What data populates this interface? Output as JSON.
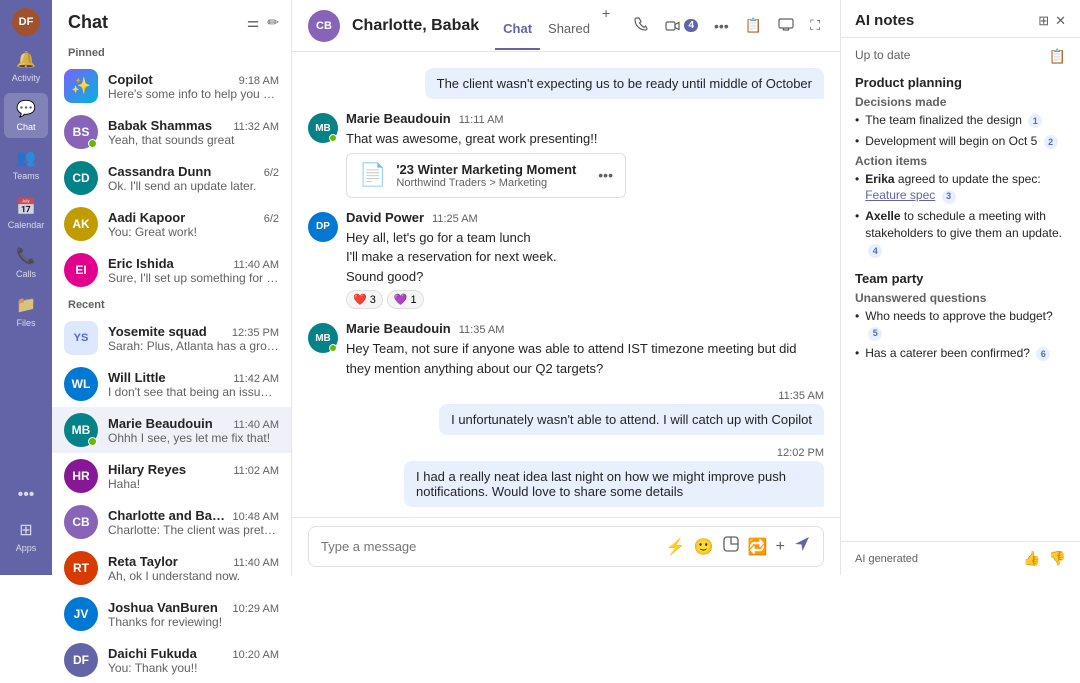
{
  "nav": {
    "items": [
      {
        "id": "activity",
        "label": "Activity",
        "icon": "🔔"
      },
      {
        "id": "chat",
        "label": "Chat",
        "icon": "💬",
        "active": true
      },
      {
        "id": "teams",
        "label": "Teams",
        "icon": "👥"
      },
      {
        "id": "calendar",
        "label": "Calendar",
        "icon": "📅"
      },
      {
        "id": "calls",
        "label": "Calls",
        "icon": "📞"
      },
      {
        "id": "files",
        "label": "Files",
        "icon": "📁"
      }
    ],
    "more_label": "•••",
    "apps_label": "Apps",
    "user_initials": "DF"
  },
  "chat_list": {
    "title": "Chat",
    "pinned_label": "Pinned",
    "recent_label": "Recent",
    "pinned": [
      {
        "id": "copilot",
        "name": "Copilot",
        "time": "9:18 AM",
        "preview": "Here's some info to help you prep for your...",
        "avatar_type": "copilot",
        "color": ""
      },
      {
        "id": "babak",
        "name": "Babak Shammas",
        "time": "11:32 AM",
        "preview": "Yeah, that sounds great",
        "avatar_type": "initial",
        "initials": "BS",
        "color": "#8764b8",
        "online": true
      },
      {
        "id": "cassandra",
        "name": "Cassandra Dunn",
        "time": "6/2",
        "preview": "Ok. I'll send an update later.",
        "avatar_type": "initial",
        "initials": "CD",
        "color": "#038387"
      },
      {
        "id": "aadi",
        "name": "Aadi Kapoor",
        "time": "6/2",
        "preview": "You: Great work!",
        "avatar_type": "initial",
        "initials": "AK",
        "color": "#c19c00"
      },
      {
        "id": "eric",
        "name": "Eric Ishida",
        "time": "11:40 AM",
        "preview": "Sure, I'll set up something for next week t...",
        "avatar_type": "initial",
        "initials": "EI",
        "color": "#e3008c"
      }
    ],
    "recent": [
      {
        "id": "yosemite",
        "name": "Yosemite squad",
        "time": "12:35 PM",
        "preview": "Sarah: Plus, Atlanta has a growing tech ...",
        "avatar_type": "group",
        "initials": "YS",
        "color": "#dde8ff"
      },
      {
        "id": "will",
        "name": "Will Little",
        "time": "11:42 AM",
        "preview": "I don't see that being an issue. Can you ta...",
        "avatar_type": "initial",
        "initials": "WL",
        "color": "#0078d4"
      },
      {
        "id": "marie",
        "name": "Marie Beaudouin",
        "time": "11:40 AM",
        "preview": "Ohhh I see, yes let me fix that!",
        "avatar_type": "initial",
        "initials": "MB",
        "color": "#038387",
        "online": true
      },
      {
        "id": "hilary",
        "name": "Hilary Reyes",
        "time": "11:02 AM",
        "preview": "Haha!",
        "avatar_type": "initial",
        "initials": "HR",
        "color": "#881798"
      },
      {
        "id": "charlotte_babak",
        "name": "Charlotte and Babak",
        "time": "10:48 AM",
        "preview": "Charlotte: The client was pretty happy with...",
        "avatar_type": "initial",
        "initials": "CB",
        "color": "#8764b8"
      },
      {
        "id": "reta",
        "name": "Reta Taylor",
        "time": "11:40 AM",
        "preview": "Ah, ok I understand now.",
        "avatar_type": "initial",
        "initials": "RT",
        "color": "#d83b01"
      },
      {
        "id": "joshua",
        "name": "Joshua VanBuren",
        "time": "10:29 AM",
        "preview": "Thanks for reviewing!",
        "avatar_type": "initial",
        "initials": "JV",
        "color": "#0078d4"
      },
      {
        "id": "daichi",
        "name": "Daichi Fukuda",
        "time": "10:20 AM",
        "preview": "You: Thank you!!",
        "avatar_type": "initial",
        "initials": "DF",
        "color": "#6264a7"
      }
    ]
  },
  "main_chat": {
    "contact_name": "Charlotte, Babak",
    "contact_initials": "CB",
    "contact_avatar_color": "#8764b8",
    "tabs": [
      {
        "id": "chat",
        "label": "Chat",
        "active": true
      },
      {
        "id": "shared",
        "label": "Shared",
        "active": false
      }
    ],
    "tab_add_icon": "+",
    "header_actions": {
      "call_icon": "📞",
      "video_count": "4",
      "more_icon": "•••",
      "notes_icon": "📝",
      "screen_icon": "🖥",
      "expand_icon": "⛶"
    },
    "messages": [
      {
        "id": "m1",
        "type": "bubble_right",
        "text": "The client wasn't expecting us to be ready until middle of October"
      },
      {
        "id": "m2",
        "type": "group",
        "sender": "Marie Beaudouin",
        "time": "11:11 AM",
        "avatar_initials": "MB",
        "avatar_color": "#038387",
        "online": true,
        "messages": [
          {
            "text": "That was awesome, great work presenting!!"
          },
          {
            "type": "attachment",
            "name": "'23 Winter Marketing Moment",
            "path": "Northwind Traders > Marketing",
            "icon": "📄"
          }
        ]
      },
      {
        "id": "m3",
        "type": "group",
        "sender": "David Power",
        "time": "11:25 AM",
        "avatar_initials": "DP",
        "avatar_color": "#0078d4",
        "messages": [
          {
            "text": "Hey all, let's go for a team lunch"
          },
          {
            "text": "I'll make a reservation for next week."
          },
          {
            "text": "Sound good?"
          }
        ],
        "reactions": [
          {
            "emoji": "❤️",
            "count": "3"
          },
          {
            "emoji": "💜",
            "count": "1"
          }
        ]
      },
      {
        "id": "m4",
        "type": "group",
        "sender": "Marie Beaudouin",
        "time": "11:35 AM",
        "avatar_initials": "MB",
        "avatar_color": "#038387",
        "online": true,
        "messages": [
          {
            "text": "Hey Team, not sure if anyone was able to attend IST timezone meeting but did they mention anything about our Q2 targets?"
          }
        ]
      },
      {
        "id": "m5",
        "type": "bubble_right",
        "time_label": "11:35 AM",
        "text": "I unfortunately wasn't able to attend. I will catch up with Copilot"
      },
      {
        "id": "m6",
        "type": "bubble_right",
        "time_label": "12:02 PM",
        "text": "I had a really neat idea last night on how we might improve push notifications. Would love to share some details"
      }
    ],
    "input_placeholder": "Type a message"
  },
  "ai_notes": {
    "title": "AI notes",
    "date_label": "Up to date",
    "sections": [
      {
        "title": "Product planning",
        "decisions_label": "Decisions made",
        "decisions": [
          {
            "text": "The team finalized the design",
            "num": "1"
          },
          {
            "text": "Development will begin on Oct 5",
            "num": "2"
          }
        ],
        "actions_label": "Action items",
        "actions": [
          {
            "bold": "Erika",
            "text": " agreed to update the spec:",
            "link": "Feature spec",
            "link_num": "3"
          },
          {
            "bold": "Axelle",
            "text": " to schedule a meeting with stakeholders to give them an update.",
            "num": "4"
          }
        ]
      },
      {
        "title": "Team party",
        "unanswered_label": "Unanswered questions",
        "questions": [
          {
            "text": "Who needs to approve the budget?",
            "num": "5"
          },
          {
            "text": "Has a caterer been confirmed?",
            "num": "6"
          }
        ]
      }
    ],
    "footer": {
      "generated_label": "AI generated",
      "thumbsup_icon": "👍",
      "thumbsdown_icon": "👎"
    }
  }
}
